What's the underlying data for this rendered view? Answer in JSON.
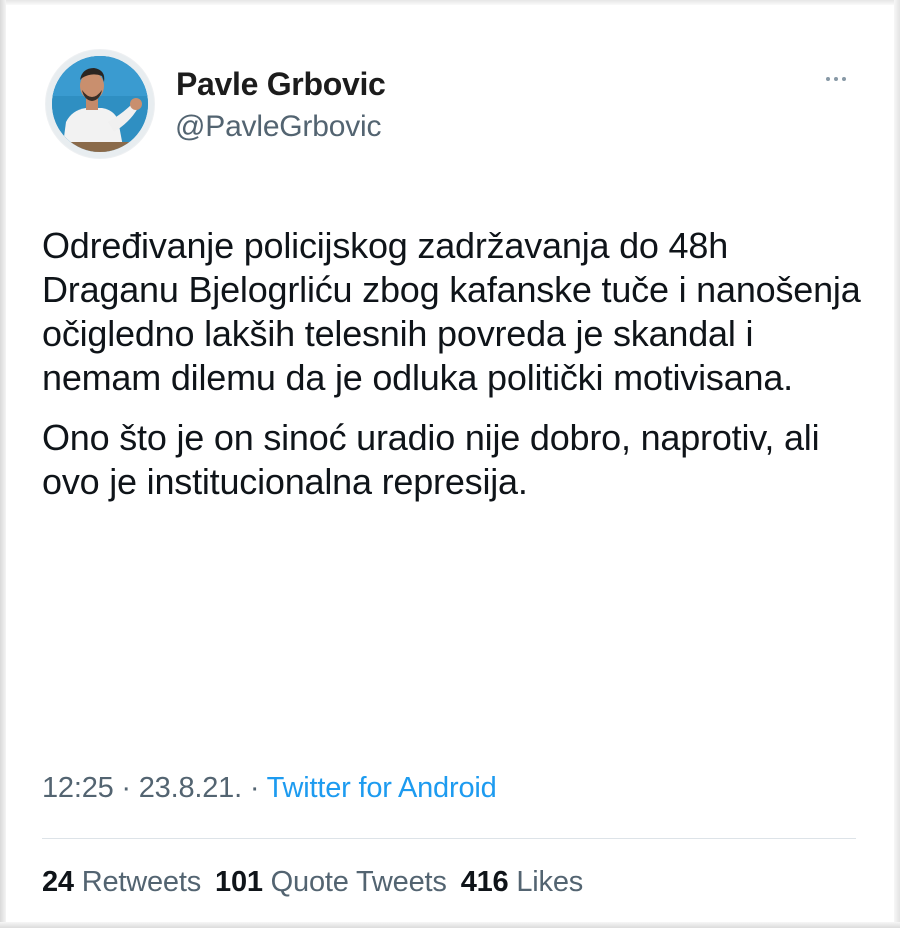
{
  "tweet": {
    "author": {
      "display_name": "Pavle Grbovic",
      "handle": "@PavleGrbovic"
    },
    "text_paragraphs": [
      "Određivanje policijskog zadržavanja do 48h Draganu Bjelogrliću zbog kafanske tuče i nanošenja očigledno lakših telesnih povreda je skandal i nemam dilemu da je odluka politički motivisana.",
      "Ono što je on sinoć uradio nije dobro, naprotiv, ali ovo je institucionalna represija."
    ],
    "meta": {
      "time": "12:25",
      "sep1": " · ",
      "date": "23.8.21.",
      "sep2": " · ",
      "source": "Twitter for Android"
    },
    "stats": {
      "retweets_count": "24",
      "retweets_label": "Retweets",
      "quotes_count": "101",
      "quotes_label": "Quote Tweets",
      "likes_count": "416",
      "likes_label": "Likes"
    }
  },
  "colors": {
    "text_primary": "#0f1419",
    "text_secondary": "#536471",
    "link": "#1d9bf0",
    "avatar_bg": "#2e8fc0"
  },
  "icons": {
    "more": "more-horizontal-icon"
  }
}
